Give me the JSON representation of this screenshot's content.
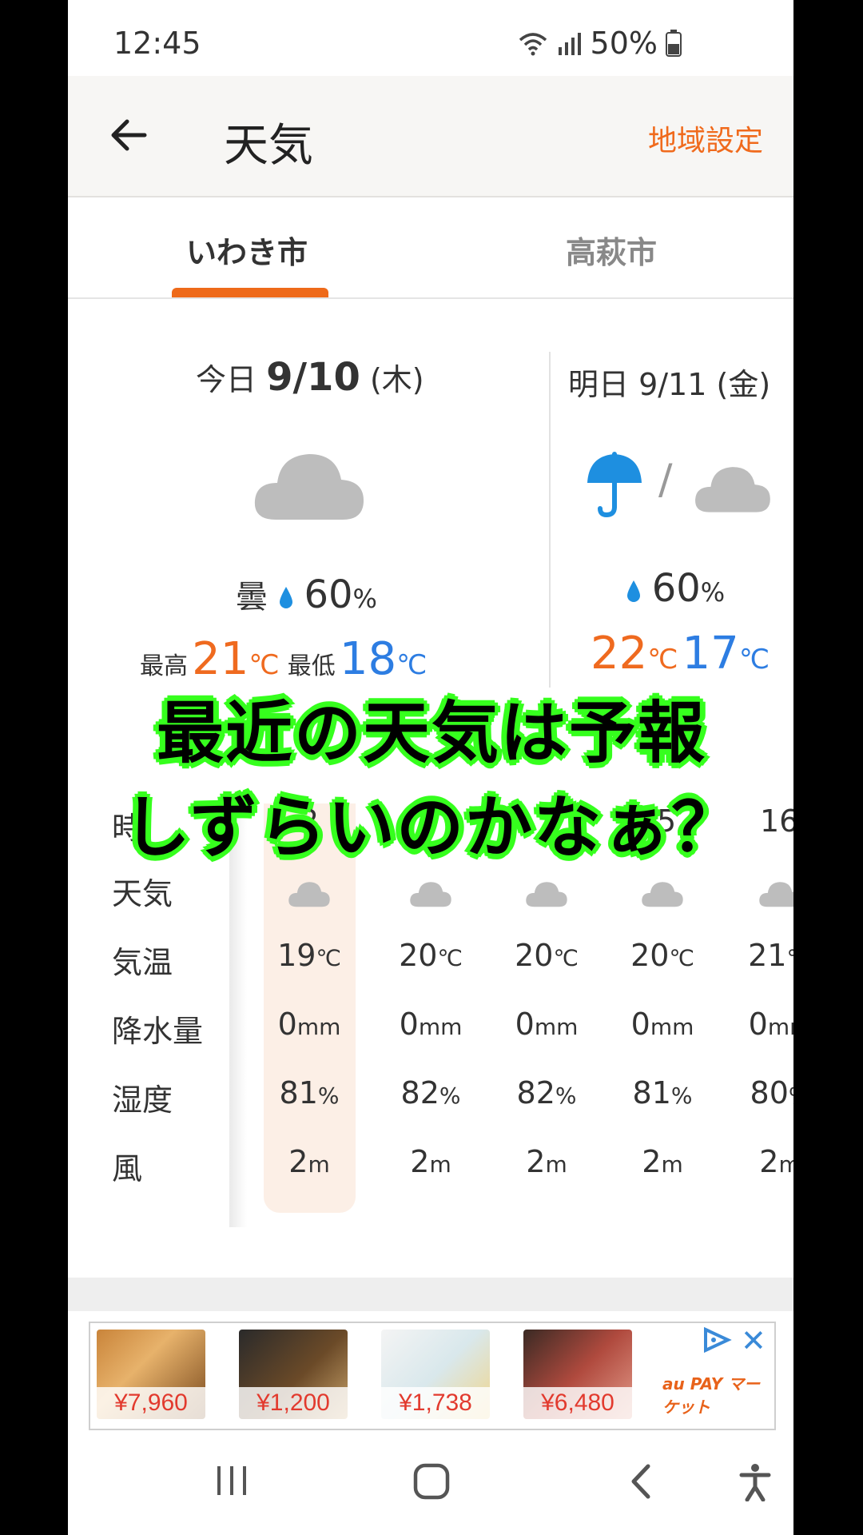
{
  "status_bar": {
    "time": "12:45",
    "battery": "50%"
  },
  "app_bar": {
    "title": "天気",
    "region_button": "地域設定"
  },
  "tabs": [
    {
      "label": "いわき市",
      "active": true
    },
    {
      "label": "高萩市",
      "active": false
    }
  ],
  "today": {
    "prefix": "今日",
    "date": "9/10",
    "weekday": "(木)",
    "condition": "曇",
    "precip": "60",
    "precip_unit": "%",
    "high_label": "最高",
    "high": "21",
    "low_label": "最低",
    "low": "18",
    "temp_unit": "℃",
    "icon": "cloud-icon"
  },
  "tomorrow": {
    "label": "明日 9/11 (金)",
    "precip": "60",
    "precip_unit": "%",
    "high": "22",
    "low": "17",
    "temp_unit": "℃",
    "icons": [
      "umbrella-icon",
      "cloud-icon"
    ],
    "separator": "/"
  },
  "hourly": {
    "row_labels": [
      "天気",
      "気温",
      "降水量",
      "湿度",
      "風"
    ],
    "hour_label_partial": "時",
    "hours_visible": [
      "2",
      "1",
      "5",
      "16"
    ],
    "columns": [
      {
        "temp": "19",
        "rain": "0",
        "humidity": "81",
        "wind": "2"
      },
      {
        "temp": "20",
        "rain": "0",
        "humidity": "82",
        "wind": "2"
      },
      {
        "temp": "20",
        "rain": "0",
        "humidity": "82",
        "wind": "2"
      },
      {
        "temp": "20",
        "rain": "0",
        "humidity": "81",
        "wind": "2"
      },
      {
        "temp": "21",
        "rain": "0",
        "humidity": "80",
        "wind": "2"
      }
    ],
    "units": {
      "temp": "℃",
      "rain": "mm",
      "humidity": "%",
      "wind": "m"
    }
  },
  "ad": {
    "items": [
      {
        "price": "¥7,960"
      },
      {
        "price": "¥1,200"
      },
      {
        "price": "¥1,738"
      },
      {
        "price": "¥6,480"
      }
    ],
    "brand": "au PAY マーケット",
    "close": "✕"
  },
  "caption": {
    "line1": "最近の天気は予報",
    "line2": "しずらいのかなぁ？"
  },
  "colors": {
    "accent": "#ee6a1a",
    "high": "#ef6a1f",
    "low": "#2d7de2",
    "caption_outline": "#37ff1f"
  }
}
